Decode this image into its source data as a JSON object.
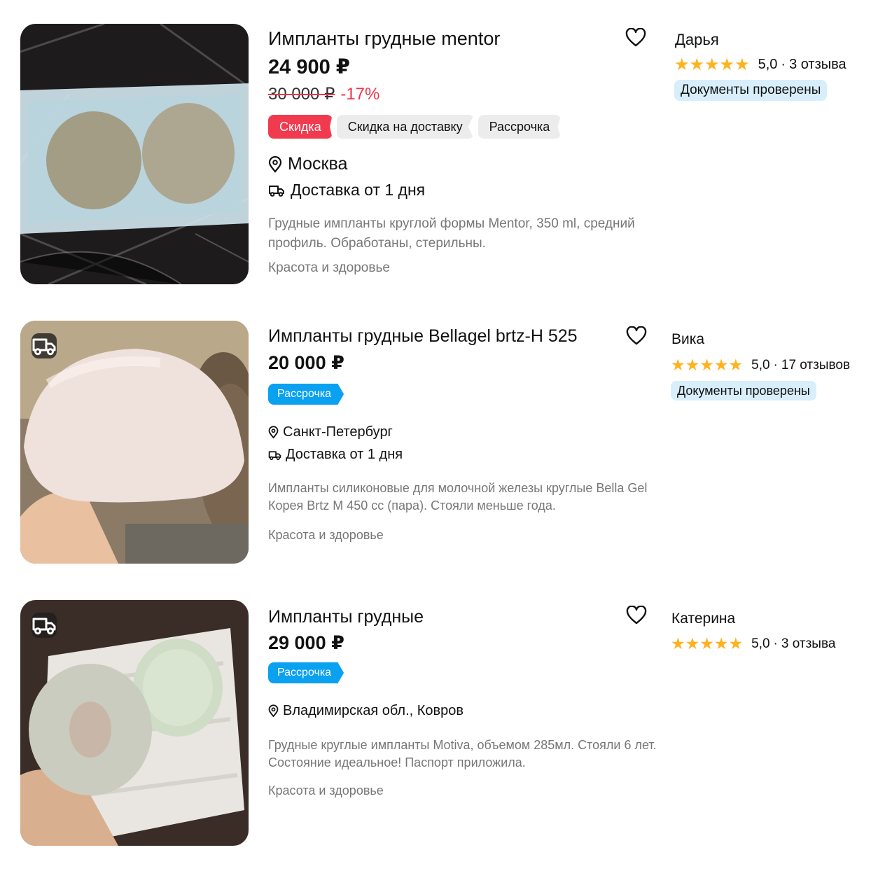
{
  "listings": [
    {
      "title": "Импланты грудные mentor",
      "price": "24 900 ₽",
      "old_price": "30 000 ₽",
      "discount": "-17%",
      "chips": [
        "Скидка",
        "Скидка на доставку",
        "Рассрочка"
      ],
      "location": "Москва",
      "delivery": "Доставка от 1 дня",
      "description": "Грудные импланты круглой формы Mentor, 350 ml, средний профиль. Обработаны, стерильны.",
      "category": "Красота и здоровье",
      "seller": {
        "name": "Дарья",
        "rating": "5,0",
        "reviews": "3 отзыва",
        "verified": "Документы проверены"
      }
    },
    {
      "title": "Импланты грудные Bellagel brtz-H 525",
      "price": "20 000 ₽",
      "chips": [
        "Рассрочка"
      ],
      "location": "Санкт-Петербург",
      "delivery": "Доставка от 1 дня",
      "description": "Импланты силиконовые для молочной железы круглые Bella Gel Корея Brtz M 450 cc (пара). Стояли меньше года.",
      "category": "Красота и здоровье",
      "seller": {
        "name": "Вика",
        "rating": "5,0",
        "reviews": "17 отзывов",
        "verified": "Документы проверены"
      }
    },
    {
      "title": "Импланты грудные",
      "price": "29 000 ₽",
      "chips": [
        "Рассрочка"
      ],
      "location": "Владимирская обл., Ковров",
      "description": "Грудные круглые импланты Motiva, объемом 285мл. Стояли 6 лет. Состояние идеальное! Паспорт приложила.",
      "category": "Красота и здоровье",
      "seller": {
        "name": "Катерина",
        "rating": "5,0",
        "reviews": "3 отзыва"
      }
    }
  ],
  "rating_separator": "·",
  "star_glyph": "★",
  "colors": {
    "discount_red": "#f23a4e",
    "installment_blue": "#0aa1f0",
    "star": "#ffb21e",
    "verified_bg": "#d8eefb"
  }
}
